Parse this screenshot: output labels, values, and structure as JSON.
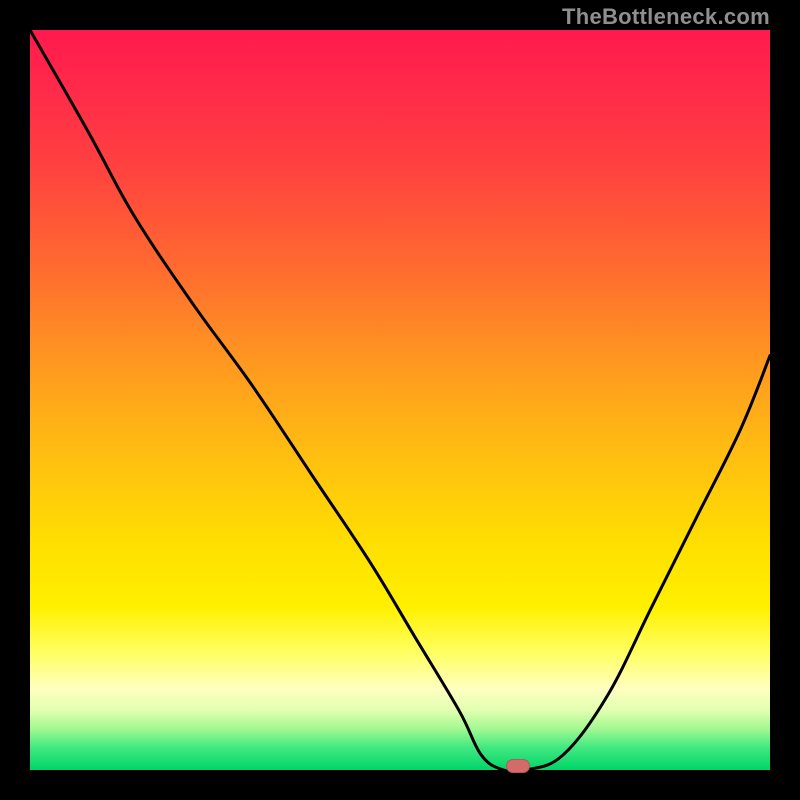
{
  "watermark": "TheBottleneck.com",
  "colors": {
    "background": "#000000",
    "curve": "#000000",
    "marker": "#d46a6a"
  },
  "chart_data": {
    "type": "line",
    "title": "",
    "xlabel": "",
    "ylabel": "",
    "xlim": [
      0,
      100
    ],
    "ylim": [
      0,
      100
    ],
    "grid": false,
    "legend": false,
    "series": [
      {
        "name": "bottleneck-curve",
        "x": [
          0,
          8,
          14,
          22,
          30,
          38,
          46,
          52,
          58,
          61,
          64,
          67,
          72,
          78,
          84,
          90,
          96,
          100
        ],
        "y": [
          100,
          86,
          75,
          63,
          52,
          40,
          28,
          18,
          8,
          2,
          0,
          0,
          2,
          10,
          22,
          34,
          46,
          56
        ]
      }
    ],
    "marker": {
      "x": 66,
      "y": 0.5
    },
    "background_gradient": "red-yellow-green vertical"
  }
}
